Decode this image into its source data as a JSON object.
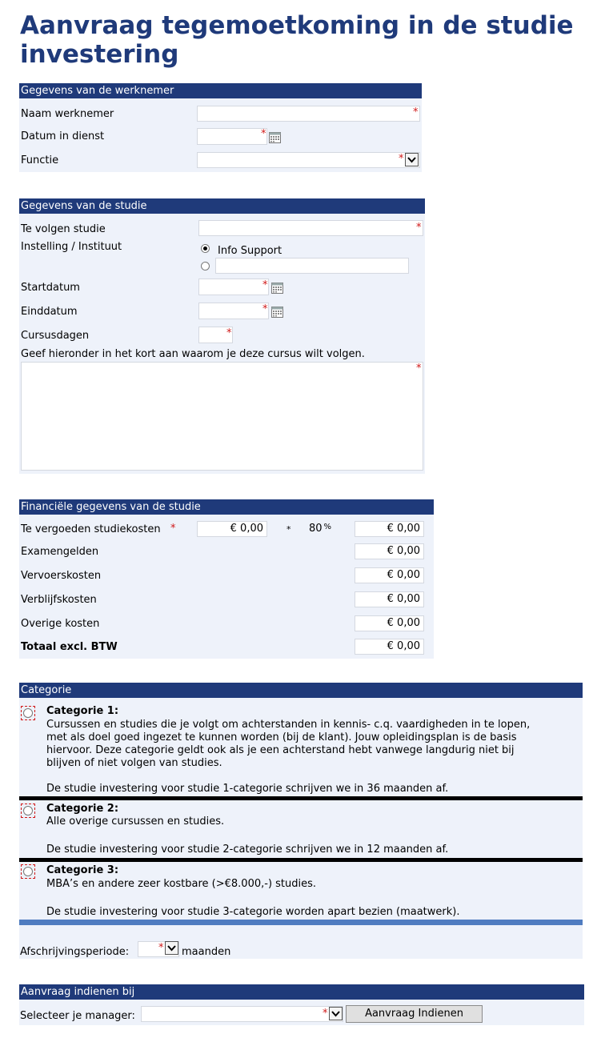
{
  "page_title": "Aanvraag tegemoetkoming in de studie investering",
  "werknemer": {
    "header": "Gegevens van de werknemer",
    "naam_label": "Naam werknemer",
    "datum_label": "Datum in dienst",
    "functie_label": "Functie",
    "required_mark": "*"
  },
  "studie": {
    "header": "Gegevens van de studie",
    "te_volgen_label": "Te volgen studie",
    "instelling_label": "Instelling / Instituut",
    "instelling_option1": "Info Support",
    "startdatum_label": "Startdatum",
    "einddatum_label": "Einddatum",
    "cursusdagen_label": "Cursusdagen",
    "motivatie_label": "Geef hieronder in het kort aan waarom je deze cursus wilt volgen."
  },
  "financieel": {
    "header": "Financiële gegevens van de studie",
    "studiekosten_label": "Te vergoeden studiekosten",
    "studiekosten_value": "€ 0,00",
    "multiply": "*",
    "percentage": "80",
    "percent_sign": "%",
    "studiekosten_result": "€ 0,00",
    "examengelden_label": "Examengelden",
    "examengelden_value": "€ 0,00",
    "vervoer_label": "Vervoerskosten",
    "vervoer_value": "€ 0,00",
    "verblijf_label": "Verblijfskosten",
    "verblijf_value": "€ 0,00",
    "overige_label": "Overige kosten",
    "overige_value": "€ 0,00",
    "totaal_label": "Totaal excl. BTW",
    "totaal_value": "€ 0,00"
  },
  "categorie": {
    "header": "Categorie",
    "cat1_title": "Categorie 1:",
    "cat1_text": "Cursussen en studies die je volgt om achterstanden in kennis- c.q. vaardigheden in te lopen, met als doel goed ingezet te kunnen worden (bij de klant). Jouw opleidingsplan is de basis hiervoor. Deze categorie geldt ook als je een achterstand hebt vanwege langdurig niet bij blijven of niet volgen van studies.",
    "cat1_note": "De studie investering voor studie 1-categorie schrijven we in 36 maanden af.",
    "cat2_title": "Categorie 2:",
    "cat2_text": "Alle overige cursussen en studies.",
    "cat2_note": "De studie investering voor studie 2-categorie schrijven we in 12 maanden af.",
    "cat3_title": "Categorie 3:",
    "cat3_text": "MBA’s en andere zeer kostbare (>€8.000,-) studies.",
    "cat3_note": "De studie investering voor studie 3-categorie worden apart bezien (maatwerk).",
    "afschrijving_label": "Afschrijvingsperiode:",
    "maanden_label": "maanden"
  },
  "indienen": {
    "header": "Aanvraag indienen bij",
    "manager_label": "Selecteer je manager:",
    "submit_label": "Aanvraag Indienen"
  },
  "icons": {
    "calendar": "calendar-icon",
    "dropdown": "chevron-down-icon"
  }
}
